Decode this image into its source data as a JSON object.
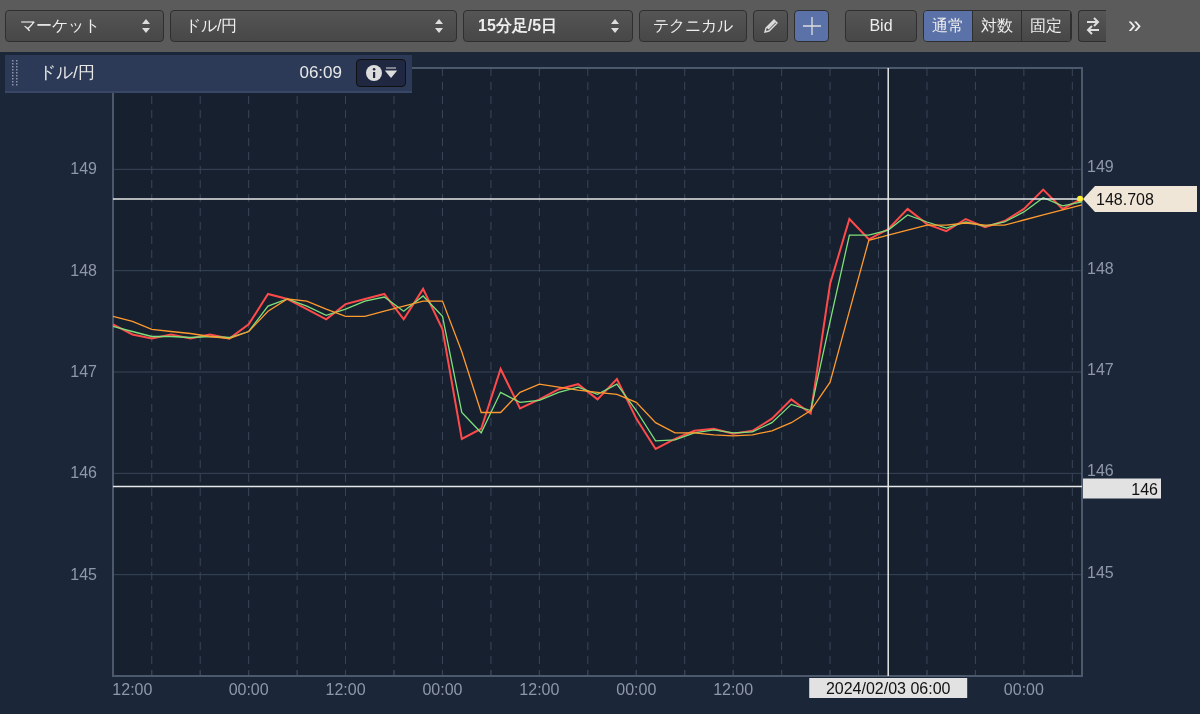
{
  "toolbar": {
    "market_select": "マーケット",
    "pair_select": "ドル/円",
    "period_select": "15分足/5日",
    "technical_button": "テクニカル",
    "tools": [
      {
        "kind": "pencil",
        "selected": false
      },
      {
        "kind": "crosshair",
        "selected": true
      }
    ],
    "bid_button": "Bid",
    "scale_modes": [
      {
        "label": "通常",
        "selected": true
      },
      {
        "label": "対数",
        "selected": false
      },
      {
        "label": "固定",
        "selected": false
      }
    ],
    "more_button": "»"
  },
  "panel": {
    "title": "ドル/円",
    "time": "06:09"
  },
  "chart": {
    "left_axis_labels": [
      "149",
      "148",
      "147",
      "146",
      "145"
    ],
    "price_tag": "148.708",
    "cursor": {
      "price_label": "146",
      "time_label": "2024/02/03 06:00"
    },
    "chart_data": {
      "type": "line",
      "categories": [
        null,
        "12:00",
        null,
        null,
        null,
        null,
        null,
        "00:00",
        null,
        null,
        null,
        null,
        "12:00",
        null,
        null,
        null,
        null,
        "00:00",
        null,
        null,
        null,
        null,
        "12:00",
        null,
        null,
        null,
        null,
        "00:00",
        null,
        null,
        null,
        null,
        "12:00",
        null,
        null,
        null,
        null,
        null,
        null,
        null,
        null,
        null,
        null,
        null,
        null,
        null,
        null,
        "00:00",
        null,
        null,
        null
      ],
      "series": [
        {
          "color": "#ff4a4a",
          "values": [
            147.47,
            147.37,
            147.33,
            147.37,
            147.33,
            147.37,
            147.33,
            147.47,
            147.77,
            147.72,
            147.62,
            147.52,
            147.67,
            147.72,
            147.77,
            147.52,
            147.82,
            147.42,
            146.34,
            146.44,
            147.03,
            146.64,
            146.73,
            146.83,
            146.88,
            146.73,
            146.93,
            146.54,
            146.24,
            146.34,
            146.42,
            146.44,
            146.39,
            146.42,
            146.54,
            146.73,
            146.59,
            147.87,
            148.51,
            148.31,
            148.41,
            148.61,
            148.46,
            148.39,
            148.51,
            148.43,
            148.49,
            148.61,
            148.8,
            148.61,
            148.71
          ]
        },
        {
          "color": "#7ee07a",
          "values": [
            147.45,
            147.4,
            147.35,
            147.35,
            147.34,
            147.35,
            147.34,
            147.4,
            147.65,
            147.72,
            147.65,
            147.56,
            147.62,
            147.7,
            147.74,
            147.6,
            147.75,
            147.55,
            146.6,
            146.4,
            146.8,
            146.7,
            146.72,
            146.8,
            146.85,
            146.78,
            146.88,
            146.62,
            146.32,
            146.33,
            146.4,
            146.43,
            146.4,
            146.41,
            146.5,
            146.68,
            146.62,
            147.5,
            148.35,
            148.35,
            148.4,
            148.55,
            148.48,
            148.42,
            148.48,
            148.44,
            148.48,
            148.58,
            148.72,
            148.64,
            148.68
          ]
        },
        {
          "color": "#ff9a2e",
          "values": [
            147.55,
            147.5,
            147.42,
            147.4,
            147.38,
            147.35,
            147.33,
            147.4,
            147.6,
            147.72,
            147.7,
            147.62,
            147.55,
            147.55,
            147.6,
            147.65,
            147.7,
            147.7,
            147.2,
            146.6,
            146.6,
            146.8,
            146.88,
            146.85,
            146.82,
            146.8,
            146.78,
            146.7,
            146.5,
            146.4,
            146.4,
            146.38,
            146.37,
            146.38,
            146.42,
            146.5,
            146.62,
            146.9,
            147.6,
            148.3,
            148.35,
            148.4,
            148.45,
            148.45,
            148.47,
            148.45,
            148.45,
            148.5,
            148.55,
            148.6,
            148.65
          ]
        }
      ],
      "ylim": [
        144,
        150
      ],
      "grid": true,
      "yticks": [
        145,
        146,
        147,
        148,
        149
      ]
    }
  }
}
